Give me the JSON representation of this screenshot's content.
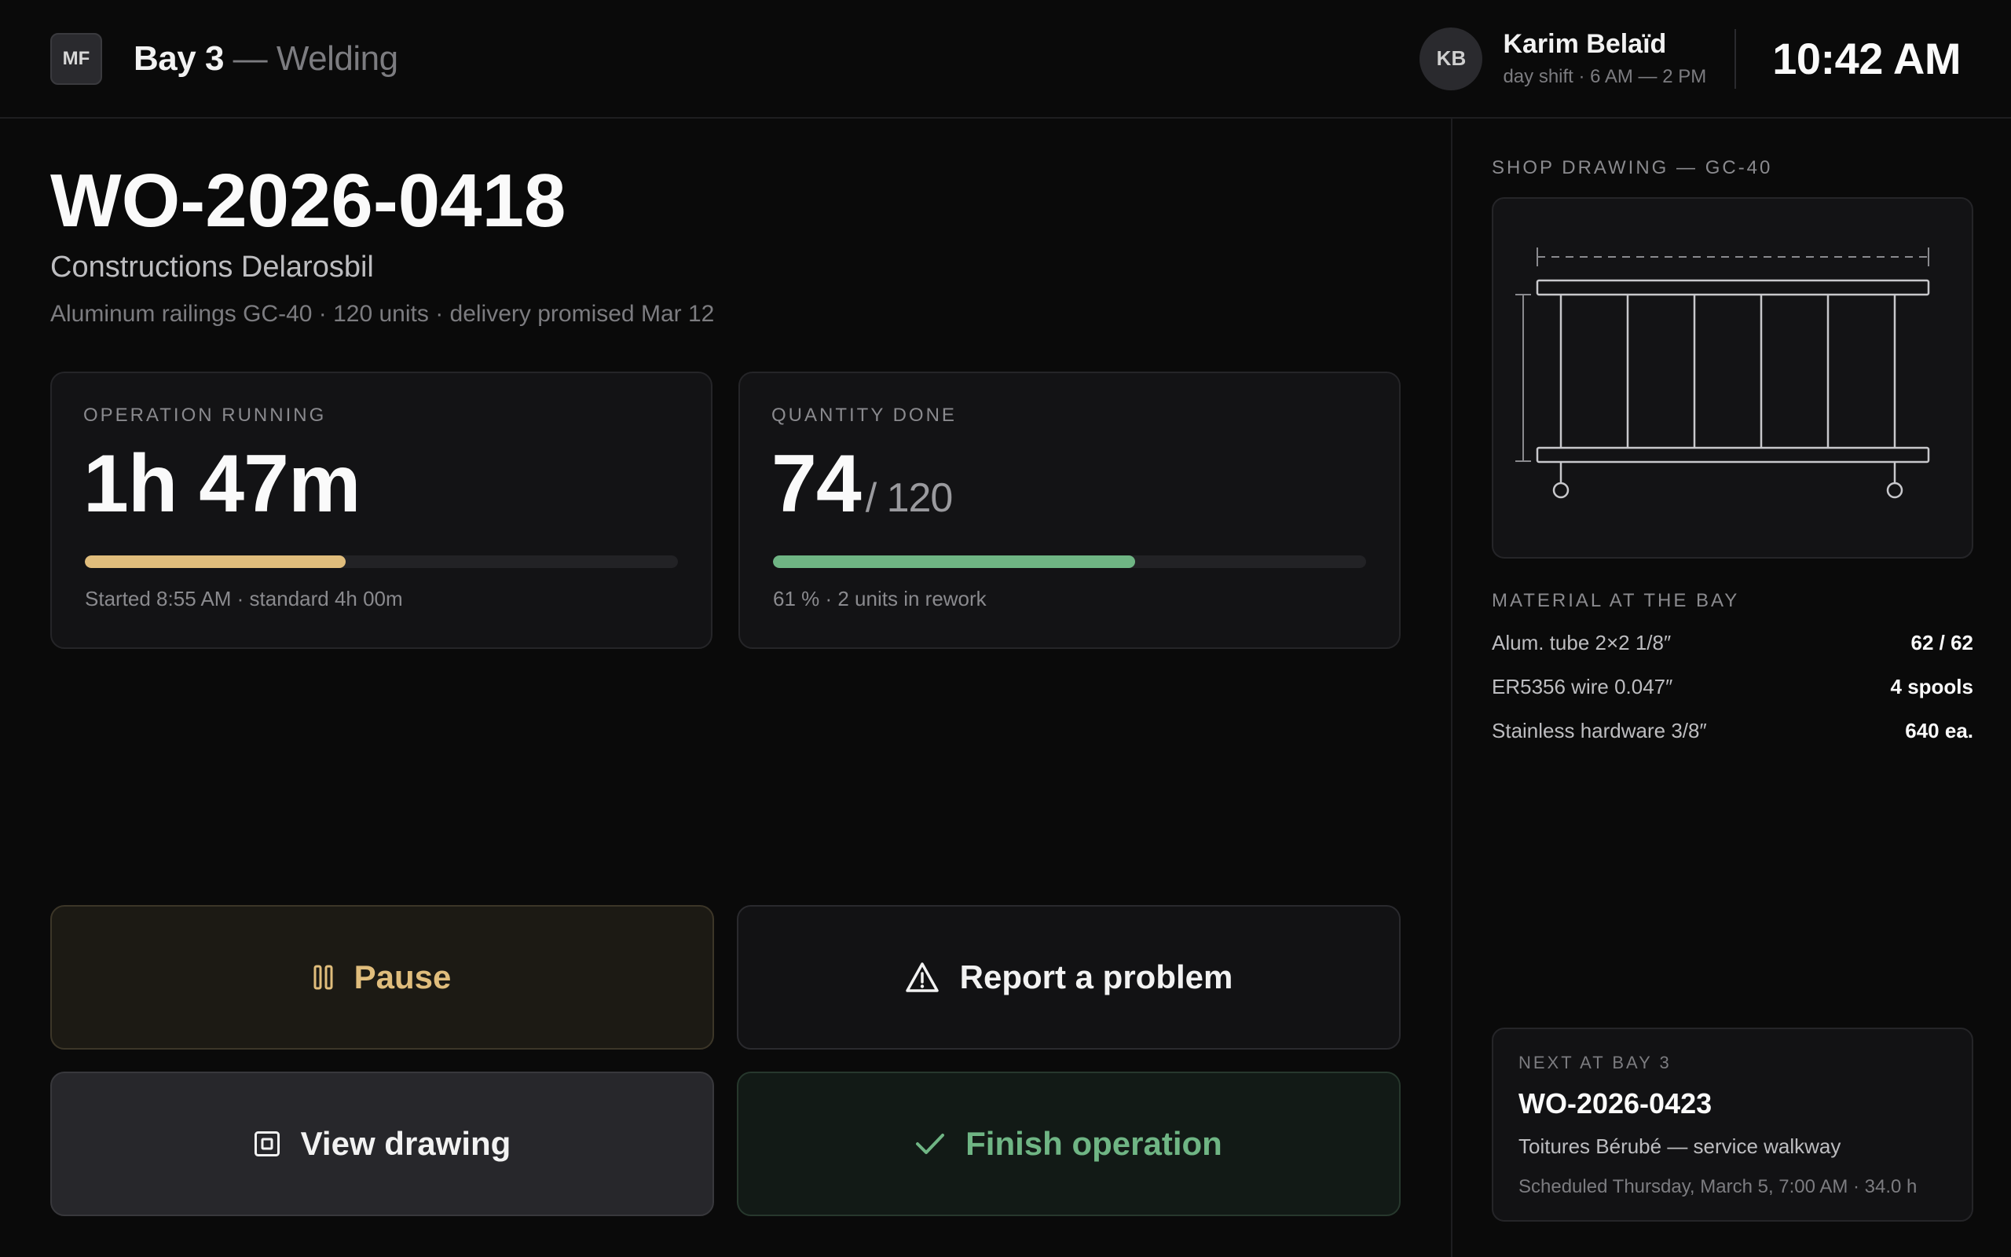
{
  "header": {
    "logo": "MF",
    "bay": "Bay 3",
    "station": "— Welding",
    "user_initials": "KB",
    "user_name": "Karim Belaïd",
    "user_shift": "day shift · 6 AM — 2 PM",
    "clock": "10:42 AM"
  },
  "order": {
    "number": "WO-2026-0418",
    "client": "Constructions Delarosbil",
    "description": "Aluminum railings GC-40 · 120 units · delivery promised Mar 12"
  },
  "operation": {
    "label": "OPERATION RUNNING",
    "elapsed": "1h 47m",
    "progress": 0.44,
    "note": "Started 8:55 AM · standard 4h 00m",
    "color": "#e0bd7c"
  },
  "quantity": {
    "label": "QUANTITY DONE",
    "done": "74",
    "total": "/ 120",
    "progress": 0.61,
    "note": "61 % · 2 units in rework",
    "color": "#6fb584"
  },
  "actions": {
    "pause": "Pause",
    "report": "Report a problem",
    "view": "View drawing",
    "finish": "Finish operation"
  },
  "drawing": {
    "label": "SHOP DRAWING — GC-40"
  },
  "material": {
    "label": "MATERIAL AT THE BAY",
    "items": [
      {
        "name": "Alum. tube 2×2 1/8″",
        "value": "62 / 62"
      },
      {
        "name": "ER5356 wire 0.047″",
        "value": "4 spools"
      },
      {
        "name": "Stainless hardware 3/8″",
        "value": "640 ea."
      }
    ]
  },
  "next": {
    "label": "NEXT AT BAY 3",
    "number": "WO-2026-0423",
    "client": "Toitures Bérubé — service walkway",
    "schedule": "Scheduled Thursday, March 5, 7:00 AM · 34.0 h"
  },
  "icons": {
    "pause": "pause-icon",
    "report": "warning-triangle-icon",
    "view": "drawing-frame-icon",
    "finish": "check-icon"
  }
}
